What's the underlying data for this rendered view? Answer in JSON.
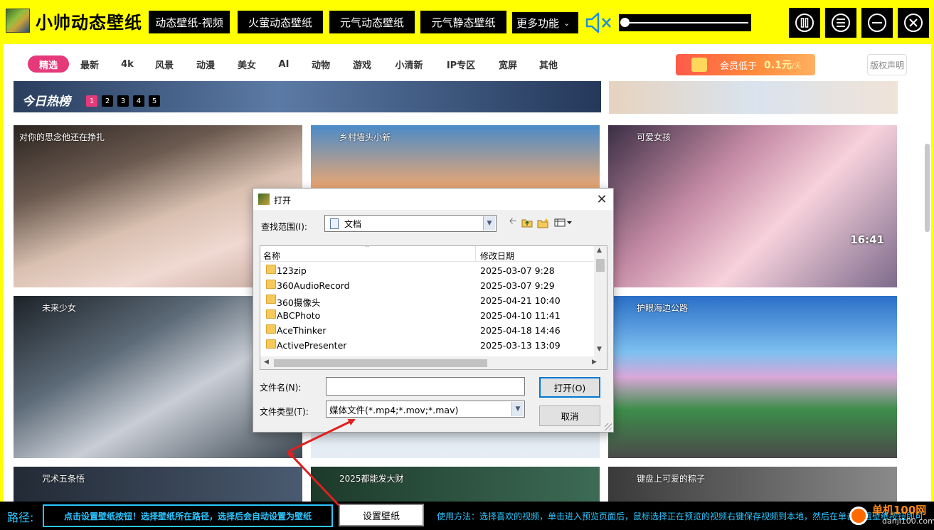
{
  "app": {
    "title": "小帅动态壁纸"
  },
  "top_buttons": [
    {
      "label": "动态壁纸-视频"
    },
    {
      "label": "火萤动态壁纸"
    },
    {
      "label": "元气动态壁纸"
    },
    {
      "label": "元气静态壁纸"
    }
  ],
  "more_menu": {
    "label": "更多功能"
  },
  "volume": {
    "level": 0.0,
    "muted": true
  },
  "categories": [
    "精选",
    "最新",
    "4k",
    "风景",
    "动漫",
    "美女",
    "AI",
    "动物",
    "游戏",
    "小清新",
    "IP专区",
    "宽屏",
    "其他"
  ],
  "active_category": "精选",
  "vip_banner": {
    "text": "会员低于",
    "price": "0.1元",
    "unit": "/天"
  },
  "copyright_label": "版权声明",
  "hot_list": {
    "title": "今日热榜",
    "pages": [
      "1",
      "2",
      "3",
      "4",
      "5"
    ],
    "active_page": "1"
  },
  "wallpapers": [
    {
      "title": "对你的思念他还在挣扎"
    },
    {
      "title": "乡村墙头小新"
    },
    {
      "title": "可爱女孩"
    },
    {
      "title": "未来少女"
    },
    {
      "title": ""
    },
    {
      "title": "护眼海边公路"
    },
    {
      "title": "咒术五条悟"
    },
    {
      "title": "2025都能发大财"
    },
    {
      "title": "键盘上可爱的粽子"
    }
  ],
  "clock_overlay": "16:41",
  "bottom": {
    "path_label": "路径:",
    "path_hint": "点击设置壁纸按钮！选择壁纸所在路径，选择后会自动设置为壁纸",
    "set_wallpaper": "设置壁纸",
    "usage": "使用方法：选择喜欢的视频，单击进入预览页面后，鼠标选择正在预览的视频右键保存视频到本地，然后在单击设置壁纸按钮即可"
  },
  "watermark": {
    "top": "单机100网",
    "bottom": "danji100.com"
  },
  "dialog": {
    "title": "打开",
    "look_in_label": "查找范围(I):",
    "look_in_value": "文档",
    "columns": {
      "name": "名称",
      "date": "修改日期"
    },
    "files": [
      {
        "name": "123zip",
        "date": "2025-03-07 9:28"
      },
      {
        "name": "360AudioRecord",
        "date": "2025-03-07 9:29"
      },
      {
        "name": "360摄像头",
        "date": "2025-04-21 10:40"
      },
      {
        "name": "ABCPhoto",
        "date": "2025-04-10 11:41"
      },
      {
        "name": "AceThinker",
        "date": "2025-04-18 14:46"
      },
      {
        "name": "ActivePresenter",
        "date": "2025-03-13 13:09"
      }
    ],
    "filename_label": "文件名(N):",
    "filename_value": "",
    "filetype_label": "文件类型(T):",
    "filetype_value": "媒体文件(*.mp4;*.mov;*.mav)",
    "open_label": "打开(O)",
    "cancel_label": "取消"
  },
  "colors": {
    "background": "#ffff00",
    "accent_pink": "#e5397a",
    "cyan_text": "#2cc6ff",
    "arrow_red": "#e02020"
  }
}
